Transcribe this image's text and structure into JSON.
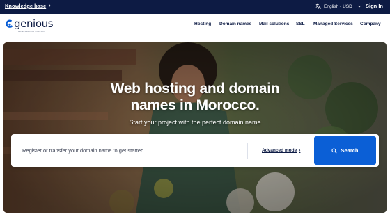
{
  "topbar": {
    "knowledge_base": "Knowledge base",
    "language": "English - USD",
    "sign_in": "Sign In"
  },
  "brand": {
    "name": "genious",
    "tagline": "RESELLERCLUB COMPANY"
  },
  "nav": {
    "items": [
      "Hosting",
      "Domain names",
      "Mail solutions",
      "SSL",
      "Managed Services",
      "Company"
    ]
  },
  "hero": {
    "title_line1": "Web hosting and domain",
    "title_line2": "names in Morocco.",
    "subtitle": "Start your project with the perfect domain name"
  },
  "search": {
    "placeholder": "Register or transfer your domain name to get started.",
    "advanced_mode": "Advanced mode",
    "button_label": "Search"
  },
  "colors": {
    "topbar_bg": "#0d1b44",
    "primary": "#0b5fd6",
    "text_dark": "#0d1b44"
  },
  "icons": {
    "language": "translate-icon",
    "language_dropdown": "chevron-down-icon",
    "knowledge_base": "chevron-right-icon",
    "advanced_mode": "chevron-right-icon",
    "search": "search-icon"
  }
}
